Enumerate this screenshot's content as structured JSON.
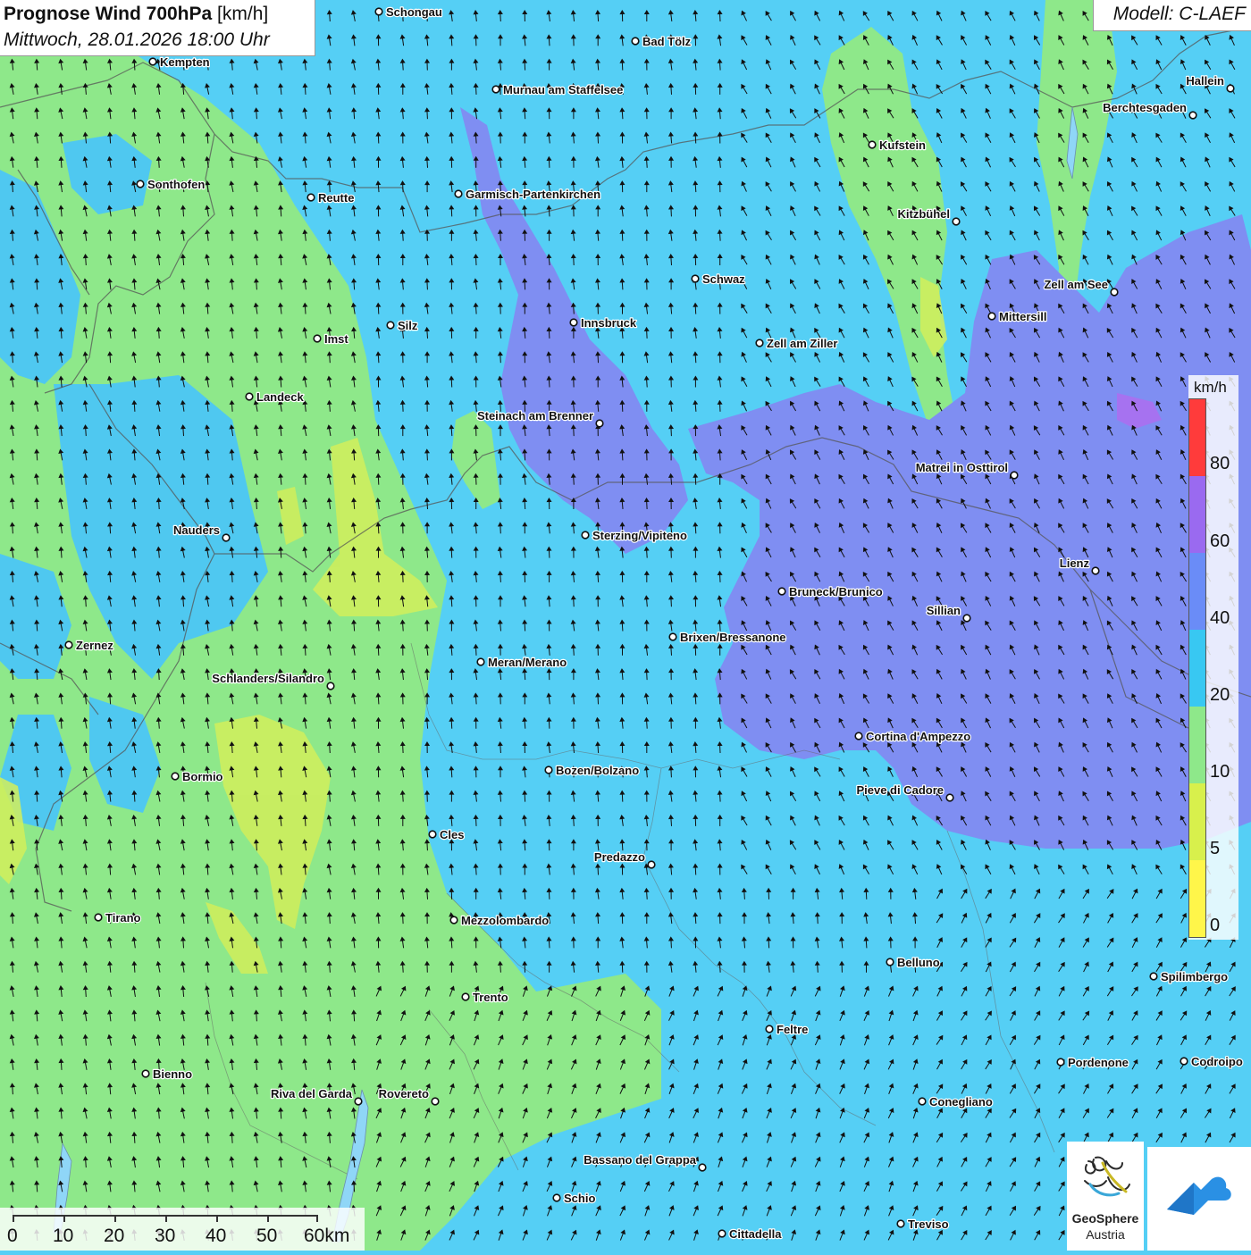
{
  "title": {
    "bold": "Prognose Wind 700hPa",
    "unit": "[km/h]",
    "date": "Mittwoch, 28.01.2026 18:00 Uhr"
  },
  "model": "Modell: C-LAEF",
  "legend": {
    "unit": "km/h",
    "labels": [
      "80",
      "60",
      "40",
      "20",
      "10",
      "5",
      "0"
    ],
    "colors": [
      "#ff3b3b",
      "#9a6af0",
      "#6a8cf7",
      "#38c8f2",
      "#8ee88a",
      "#d8f04c",
      "#fff64a"
    ]
  },
  "scale": {
    "labels": [
      "0",
      "10",
      "20",
      "30",
      "40",
      "50",
      "60km"
    ]
  },
  "logo": {
    "name": "GeoSphere",
    "sub": "Austria"
  },
  "wind_arrow_icon": "arrow-up-icon",
  "cities": [
    {
      "name": "Schongau"
    },
    {
      "name": "Kempten"
    },
    {
      "name": "Bad Tölz"
    },
    {
      "name": "Murnau am Staffelsee"
    },
    {
      "name": "Hallein"
    },
    {
      "name": "Berchtesgaden"
    },
    {
      "name": "Kufstein"
    },
    {
      "name": "Sonthofen"
    },
    {
      "name": "Reutte"
    },
    {
      "name": "Garmisch-Partenkirchen"
    },
    {
      "name": "Kitzbühel"
    },
    {
      "name": "Schwaz"
    },
    {
      "name": "Zell am See"
    },
    {
      "name": "Innsbruck"
    },
    {
      "name": "Mittersill"
    },
    {
      "name": "Silz"
    },
    {
      "name": "Imst"
    },
    {
      "name": "Zell am Ziller"
    },
    {
      "name": "Landeck"
    },
    {
      "name": "Steinach am Brenner"
    },
    {
      "name": "Matrei in Osttirol"
    },
    {
      "name": "Nauders"
    },
    {
      "name": "Sterzing/Vipiteno"
    },
    {
      "name": "Lienz"
    },
    {
      "name": "Bruneck/Brunico"
    },
    {
      "name": "Sillian"
    },
    {
      "name": "Zernez"
    },
    {
      "name": "Brixen/Bressanone"
    },
    {
      "name": "Meran/Merano"
    },
    {
      "name": "Schlanders/Silandro"
    },
    {
      "name": "Cortina d'Ampezzo"
    },
    {
      "name": "Bozen/Bolzano"
    },
    {
      "name": "Bormio"
    },
    {
      "name": "Pieve di Cadore"
    },
    {
      "name": "Cles"
    },
    {
      "name": "Predazzo"
    },
    {
      "name": "Tirano"
    },
    {
      "name": "Mezzolombardo"
    },
    {
      "name": "Belluno"
    },
    {
      "name": "Spilimbergo"
    },
    {
      "name": "Trento"
    },
    {
      "name": "Feltre"
    },
    {
      "name": "Pordenone"
    },
    {
      "name": "Codroipo"
    },
    {
      "name": "Bienno"
    },
    {
      "name": "Riva del Garda"
    },
    {
      "name": "Rovereto"
    },
    {
      "name": "Conegliano"
    },
    {
      "name": "Bassano del Grappa"
    },
    {
      "name": "Schio"
    },
    {
      "name": "Treviso"
    },
    {
      "name": "Cittadella"
    }
  ]
}
